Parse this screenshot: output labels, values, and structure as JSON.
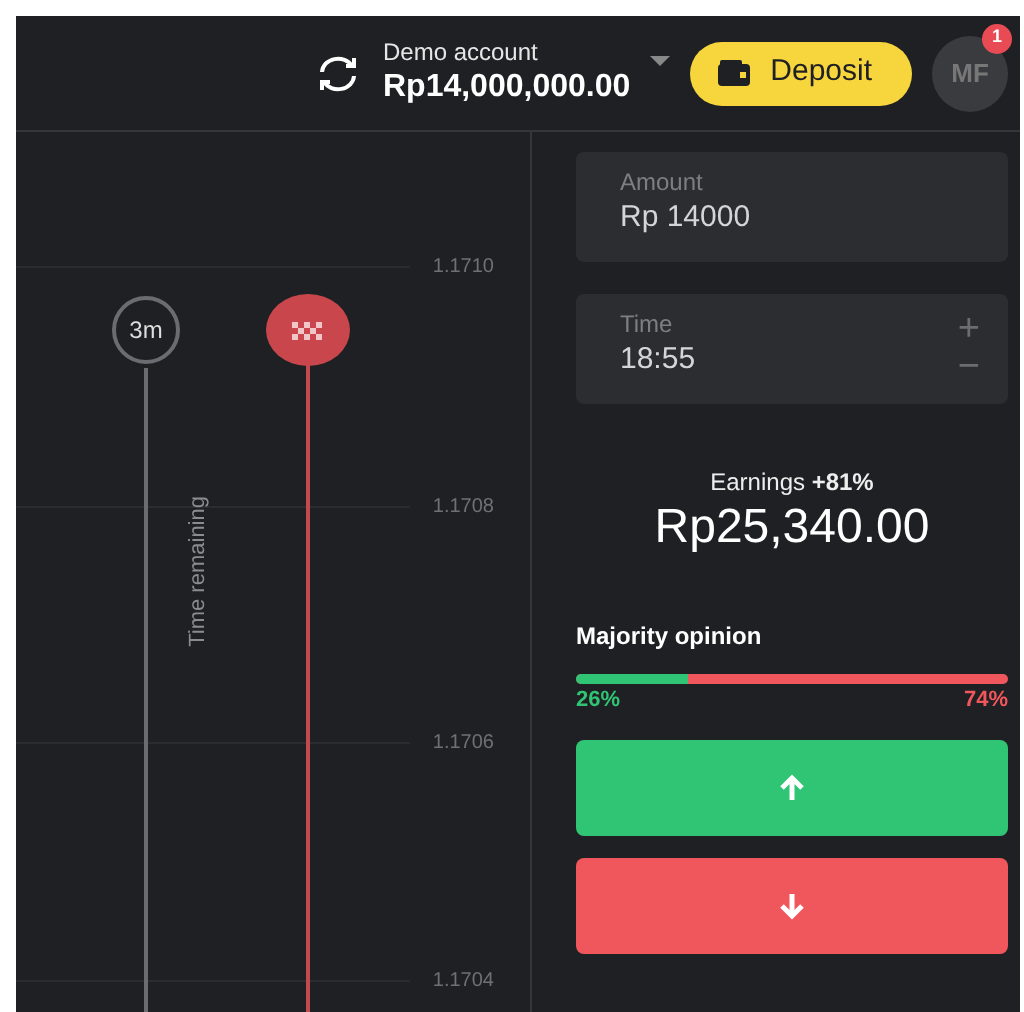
{
  "header": {
    "account_label": "Demo account",
    "balance": "Rp14,000,000.00",
    "deposit": "Deposit",
    "avatar": "MF",
    "notifications": "1"
  },
  "chart": {
    "price_labels": [
      "1.1710",
      "1.1708",
      "1.1706",
      "1.1704"
    ],
    "timer": "3m",
    "timer_caption": "Time remaining"
  },
  "trade": {
    "amount": {
      "label": "Amount",
      "value": "Rp 14000"
    },
    "time": {
      "label": "Time",
      "value": "18:55",
      "plus": "+",
      "minus": "−"
    },
    "earnings_label": "Earnings **+81%**",
    "earnings": "Rp25,340.00",
    "majority": {
      "title": "Majority opinion",
      "level": 0.26,
      "up_label": "26%",
      "down_label": "74%"
    },
    "buttons": [
      {
        "kind": "up"
      },
      {
        "kind": "down"
      }
    ]
  }
}
